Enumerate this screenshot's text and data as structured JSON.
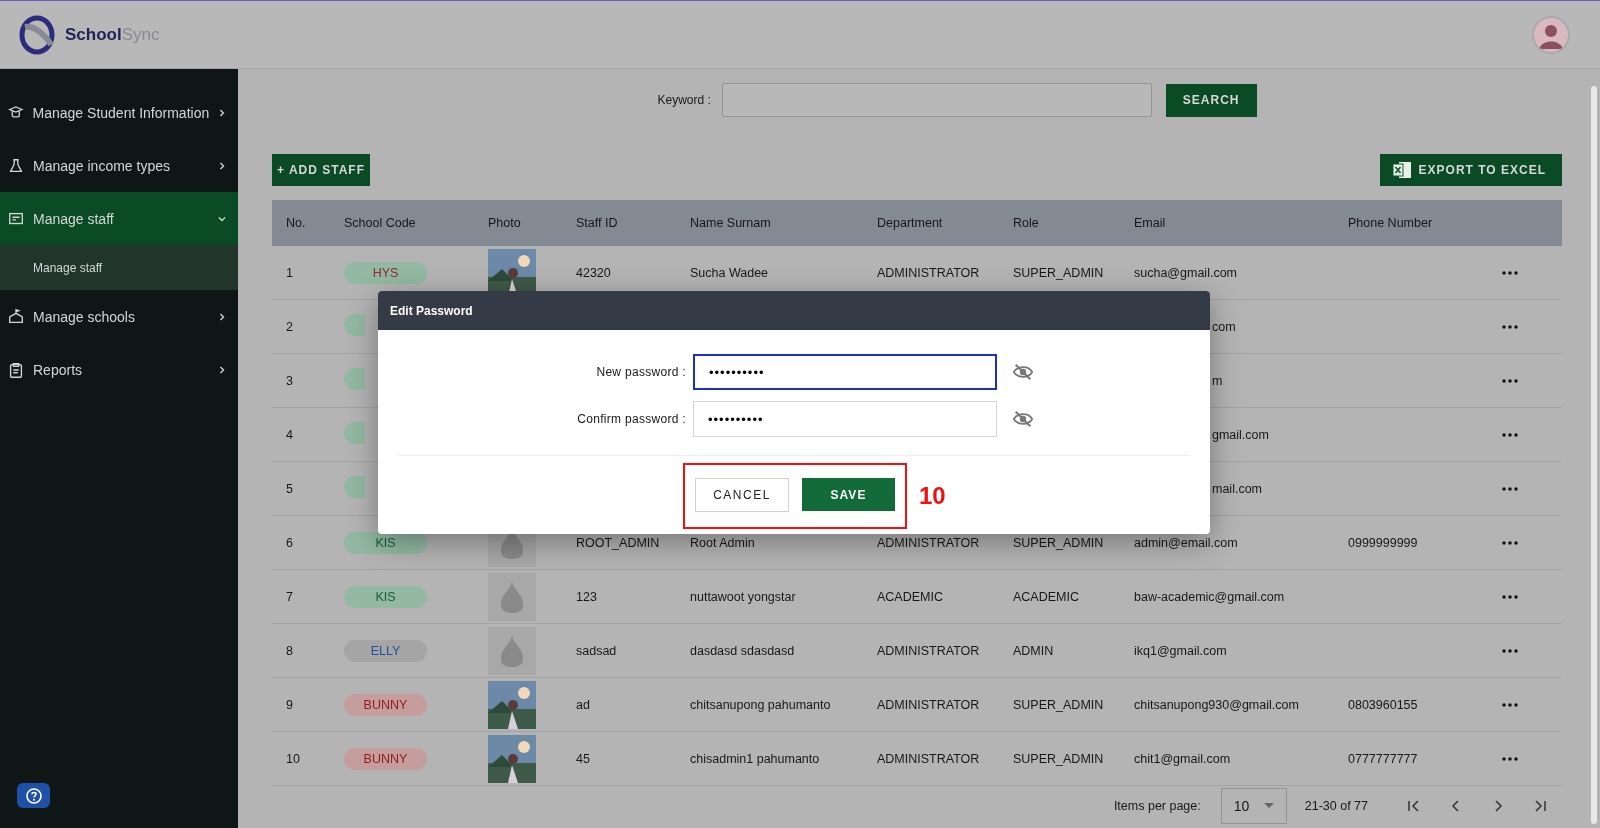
{
  "app": {
    "logo_primary": "School",
    "logo_secondary": "Sync"
  },
  "sidebar": {
    "items": [
      {
        "label": "Manage Student Information",
        "expanded": false,
        "selected": false
      },
      {
        "label": "Manage income types",
        "expanded": false,
        "selected": false
      },
      {
        "label": "Manage staff",
        "expanded": true,
        "selected": true,
        "children": [
          {
            "label": "Manage staff",
            "selected": true
          }
        ]
      },
      {
        "label": "Manage schools",
        "expanded": false,
        "selected": false
      },
      {
        "label": "Reports",
        "expanded": false,
        "selected": false
      }
    ]
  },
  "search": {
    "label": "Keyword :",
    "button": "SEARCH"
  },
  "toolbar": {
    "add_button": "+ ADD STAFF",
    "export_button": "EXPORT TO EXCEL"
  },
  "table": {
    "columns": [
      "No.",
      "School Code",
      "Photo",
      "Staff ID",
      "Name Surnam",
      "Department",
      "Role",
      "Email",
      "Phone Number"
    ],
    "rows": [
      {
        "no": "1",
        "school_code": {
          "color": "#93b9a2",
          "label": {
            "text": "HYS",
            "color": "#9c2435"
          }
        },
        "staff_id": "42320",
        "name": "Sucha Wadee",
        "department": "ADMINISTRATOR",
        "role": "SUPER_ADMIN",
        "email": "sucha@gmail.com",
        "covered": false
      },
      {
        "no": "2",
        "school_code": {
          "color": "#93b9a2"
        },
        "email": "com",
        "covered": true
      },
      {
        "no": "3",
        "school_code": {
          "color": "#93b9a2"
        },
        "email": "m",
        "covered": true
      },
      {
        "no": "4",
        "school_code": {
          "color": "#93b9a2"
        },
        "email": "gmail.com",
        "covered": true
      },
      {
        "no": "5",
        "school_code": {
          "color": "#93b9a2"
        },
        "email": "mail.com",
        "covered": true
      },
      {
        "no": "6",
        "school_code": {
          "color": "#93b9a2",
          "label": {
            "text": "KIS",
            "color": "#136036"
          }
        },
        "photo": {
          "kind": "placeholder"
        },
        "staff_id": "ROOT_ADMIN",
        "name": "Root Admin",
        "department": "ADMINISTRATOR",
        "role": "SUPER_ADMIN",
        "email": "admin@email.com",
        "phone": "0999999999",
        "covered": false
      },
      {
        "no": "7",
        "school_code": {
          "color": "#93b9a2",
          "label": {
            "text": "KIS",
            "color": "#136036"
          }
        },
        "photo": {
          "kind": "placeholder"
        },
        "staff_id": "123",
        "name": "nuttawoot yongstar",
        "department": "ACADEMIC",
        "role": "ACADEMIC",
        "email": "baw-academic@gmail.com",
        "covered": false
      },
      {
        "no": "8",
        "school_code": {
          "color": "#a5a5a5",
          "label": {
            "text": "ELLY",
            "color": "#2250a0"
          }
        },
        "photo": {
          "kind": "placeholder"
        },
        "staff_id": "sadsad",
        "name": "dasdasd sdasdasd",
        "department": "ADMINISTRATOR",
        "role": "ADMIN",
        "email": "ikq1@gmail.com",
        "covered": false
      },
      {
        "no": "9",
        "school_code": {
          "color": "#c69d9d",
          "label": {
            "text": "BUNNY",
            "color": "#8f1d1d"
          }
        },
        "staff_id": "ad",
        "name": "chitsanupong pahumanto",
        "department": "ADMINISTRATOR",
        "role": "SUPER_ADMIN",
        "email": "chitsanupong930@gmail.com",
        "phone": "0803960155",
        "covered": false
      },
      {
        "no": "10",
        "school_code": {
          "color": "#c69d9d",
          "label": {
            "text": "BUNNY",
            "color": "#8f1d1d"
          }
        },
        "staff_id": "45",
        "name": "chisadmin1 pahumanto",
        "department": "ADMINISTRATOR",
        "role": "SUPER_ADMIN",
        "email": "chit1@gmail.com",
        "phone": "0777777777",
        "covered": false
      }
    ]
  },
  "pagination": {
    "label": "Items per page:",
    "page_size": "10",
    "range": "21-30 of 77"
  },
  "dialog": {
    "title": "Edit Password",
    "fields": [
      {
        "label": "New password :",
        "value": "••••••••••",
        "focused": true
      },
      {
        "label": "Confirm password :",
        "value": "••••••••••",
        "focused": false
      }
    ],
    "cancel_button": "CANCEL",
    "save_button": "SAVE",
    "annotation": "10"
  }
}
